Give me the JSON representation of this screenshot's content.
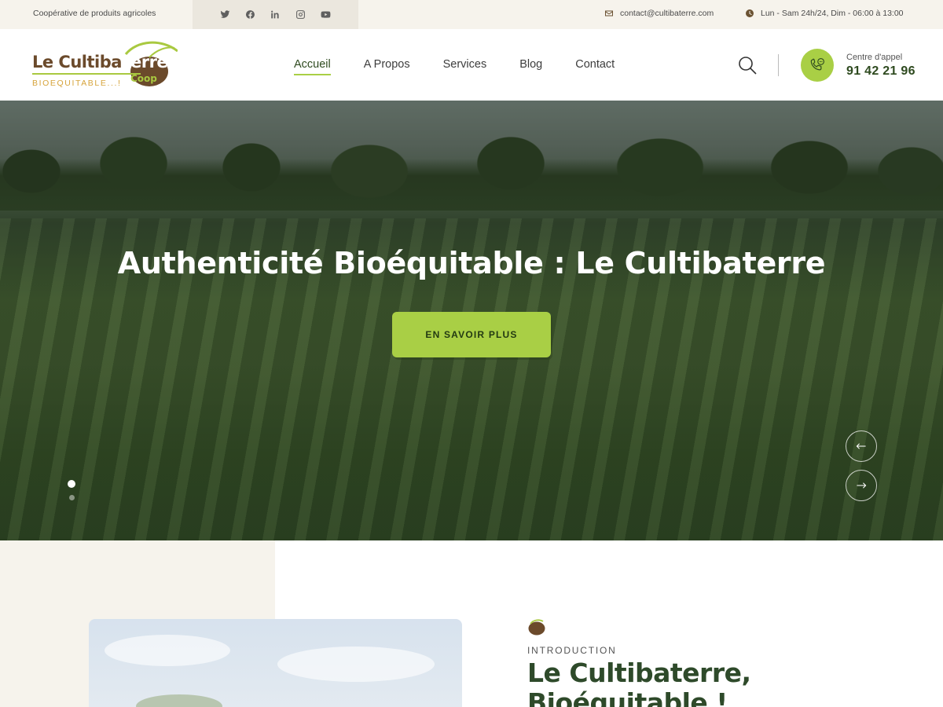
{
  "topbar": {
    "tagline": "Coopérative de produits agricoles",
    "social": [
      "twitter-icon",
      "facebook-icon",
      "linkedin-icon",
      "instagram-icon",
      "youtube-icon"
    ],
    "email": "contact@cultibaterre.com",
    "hours": "Lun - Sam 24h/24, Dim - 06:00 à 13:00"
  },
  "logo": {
    "main_prefix": "Le Cultiba",
    "main_suffix": "Terre",
    "coop": "Coop",
    "sub": "BIOEQUITABLE...!"
  },
  "nav": {
    "items": [
      {
        "label": "Accueil",
        "active": true
      },
      {
        "label": "A Propos",
        "active": false
      },
      {
        "label": "Services",
        "active": false
      },
      {
        "label": "Blog",
        "active": false
      },
      {
        "label": "Contact",
        "active": false
      }
    ]
  },
  "call": {
    "label": "Centre d'appel",
    "number": "91 42 21 96"
  },
  "hero": {
    "title": "Authenticité Bioéquitable : Le Cultibaterre",
    "button": "EN SAVOIR PLUS",
    "slides": 2,
    "active_slide": 1
  },
  "intro": {
    "label": "INTRODUCTION",
    "title_line1": "Le Cultibaterre,",
    "title_line2": "Bioéquitable !"
  },
  "colors": {
    "accent": "#a9cf45",
    "dark_green": "#2e4a2a",
    "brown": "#6b4a2b",
    "topbar_bg": "#f6f3ec"
  }
}
